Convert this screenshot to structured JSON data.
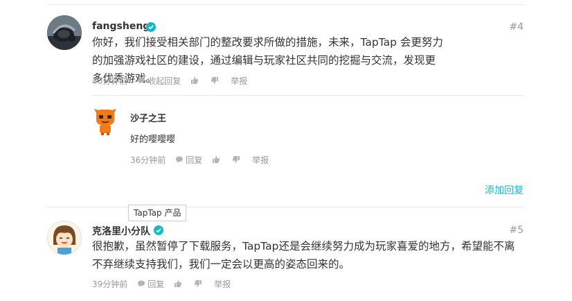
{
  "colors": {
    "accent": "#14b9c8",
    "meta": "#999999",
    "divider": "#e8e8e8"
  },
  "comments": [
    {
      "username": "fangsheng",
      "verified": true,
      "floor": "#4",
      "content": "你好，我们接受相关部门的整改要求所做的措施，未来，TapTap 会更努力的加强游戏社区的建设，通过编辑与玩家社区共同的挖掘与交流，发现更多优秀游戏。",
      "time": "40分钟前",
      "reply_label": "收起回复",
      "report_label": "举报",
      "icons": [
        "reply-icon",
        "thumb-up-icon",
        "thumb-down-icon"
      ],
      "replies": [
        {
          "username": "沙子之王",
          "content": "好的嘤嘤嘤",
          "time": "36分钟前",
          "reply_label": "回复",
          "report_label": "举报"
        }
      ],
      "add_reply_label": "添加回复"
    },
    {
      "username": "克洛里小分队",
      "verified": true,
      "floor": "#5",
      "content": "很抱歉，虽然暂停了下载服务，TapTap还是会继续努力成为玩家喜爱的地方，希望能不离不弃继续支持我们，我们一定会以更高的姿态回来的。",
      "time": "39分钟前",
      "reply_label": "回复",
      "report_label": "举报",
      "tooltip": "TapTap 产品"
    }
  ]
}
